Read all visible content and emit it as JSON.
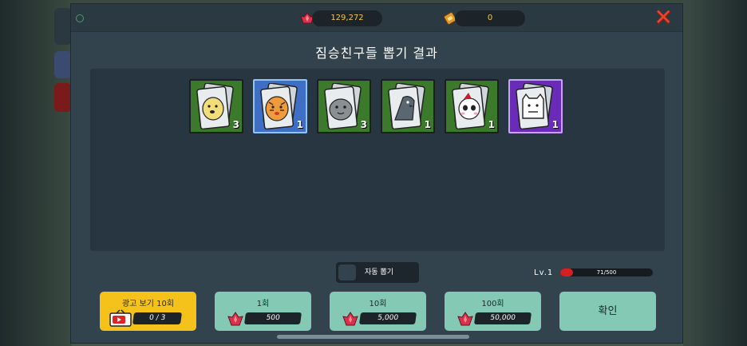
{
  "currency": {
    "gems": "129,272",
    "tickets": "0"
  },
  "title": "짐승친구들 뽑기 결과",
  "results": [
    {
      "animal": "dog",
      "count": "3",
      "rarity": "green"
    },
    {
      "animal": "tiger",
      "count": "1",
      "rarity": "blue"
    },
    {
      "animal": "seal",
      "count": "3",
      "rarity": "green"
    },
    {
      "animal": "penguin",
      "count": "1",
      "rarity": "green"
    },
    {
      "animal": "panda",
      "count": "1",
      "rarity": "green"
    },
    {
      "animal": "polar-bear",
      "count": "1",
      "rarity": "purple"
    }
  ],
  "auto_draw": {
    "label": "자동 뽑기"
  },
  "level": {
    "label": "Lv.1",
    "xp_text": "71/500",
    "xp_fraction": 0.142
  },
  "buttons": {
    "ad": {
      "label": "광고 보기 10회",
      "progress": "0 / 3"
    },
    "draw1": {
      "label": "1회",
      "price": "500"
    },
    "draw10": {
      "label": "10회",
      "price": "5,000"
    },
    "draw100": {
      "label": "100회",
      "price": "50,000"
    },
    "confirm": {
      "label": "확인"
    }
  },
  "colors": {
    "green": "#3a7a2a",
    "blue": "#3f6fc4",
    "purple": "#6a2cb8",
    "accent_yellow": "#f5c21b",
    "mint": "#84c9b3",
    "close_red": "#e8432e"
  }
}
